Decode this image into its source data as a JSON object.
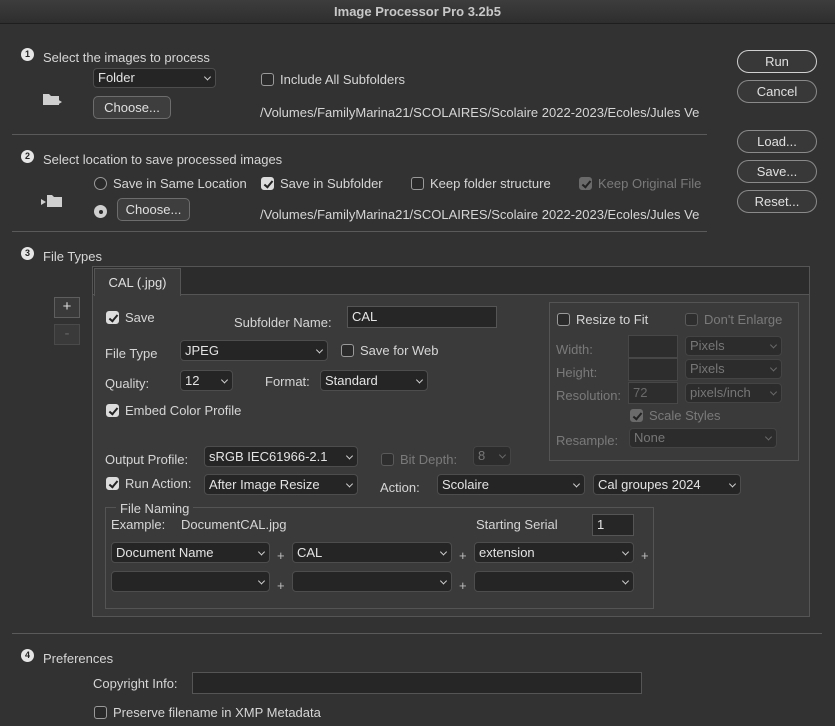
{
  "window": {
    "title": "Image Processor Pro 3.2b5"
  },
  "steps": [
    "1",
    "2",
    "3",
    "4"
  ],
  "section1": {
    "heading": "Select the images to process",
    "source_select": "Folder",
    "include_subfolders": "Include All Subfolders",
    "choose": "Choose...",
    "path": "/Volumes/FamilyMarina21/SCOLAIRES/Scolaire 2022-2023/Ecoles/Jules Ve"
  },
  "section2": {
    "heading": "Select location to save processed images",
    "save_same": "Save in Same Location",
    "save_subfolder": "Save in Subfolder",
    "keep_structure": "Keep folder structure",
    "keep_original": "Keep Original File",
    "choose": "Choose...",
    "path": "/Volumes/FamilyMarina21/SCOLAIRES/Scolaire 2022-2023/Ecoles/Jules Ve"
  },
  "side_buttons": {
    "run": "Run",
    "cancel": "Cancel",
    "load": "Load...",
    "save": "Save...",
    "reset": "Reset..."
  },
  "section3": {
    "heading": "File Types",
    "add": "+",
    "remove": "-",
    "tab": "CAL (.jpg)",
    "save": "Save",
    "subfolder_label": "Subfolder Name:",
    "subfolder_value": "CAL",
    "file_type_label": "File Type",
    "file_type": "JPEG",
    "save_for_web": "Save for Web",
    "quality_label": "Quality:",
    "quality": "12",
    "format_label": "Format:",
    "format": "Standard",
    "embed_profile": "Embed Color Profile",
    "output_profile_label": "Output Profile:",
    "output_profile": "sRGB IEC61966-2.1",
    "bit_depth_label": "Bit Depth:",
    "bit_depth": "8",
    "run_action": "Run Action:",
    "run_action_when": "After Image Resize",
    "action_label": "Action:",
    "action_set": "Scolaire",
    "action": "Cal groupes 2024",
    "resize": {
      "resize_to_fit": "Resize to Fit",
      "dont_enlarge": "Don't Enlarge",
      "width_label": "Width:",
      "width_unit": "Pixels",
      "height_label": "Height:",
      "height_unit": "Pixels",
      "resolution_label": "Resolution:",
      "resolution": "72",
      "resolution_unit": "pixels/inch",
      "scale_styles": "Scale Styles",
      "resample_label": "Resample:",
      "resample": "None"
    },
    "naming": {
      "title": "File Naming",
      "example_label": "Example:",
      "example": "DocumentCAL.jpg",
      "serial_label": "Starting Serial",
      "serial": "1",
      "row1": [
        "Document Name",
        "CAL",
        "extension"
      ],
      "row2": [
        "",
        "",
        ""
      ],
      "plus": "+"
    }
  },
  "section4": {
    "heading": "Preferences",
    "copyright_label": "Copyright Info:",
    "copyright": "",
    "preserve": "Preserve filename in XMP Metadata"
  }
}
